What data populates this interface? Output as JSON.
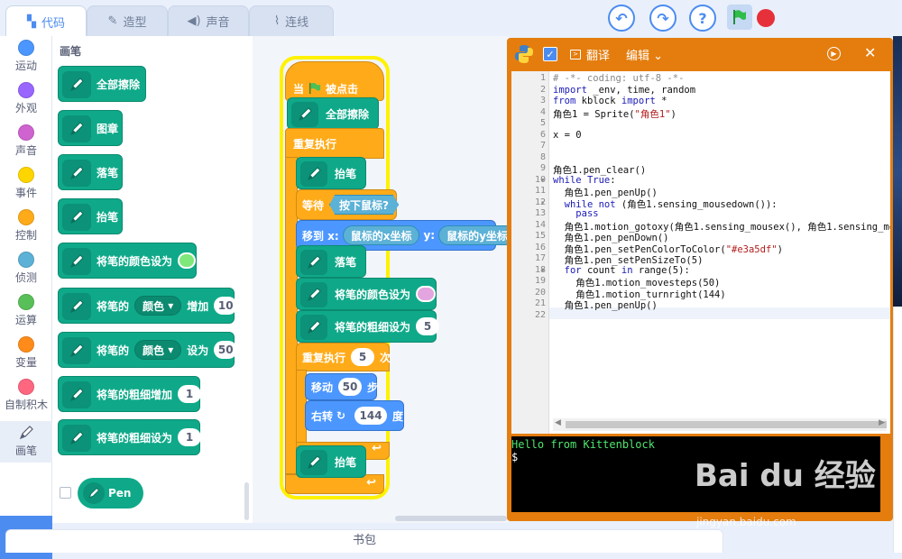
{
  "tabs": [
    {
      "label": "代码",
      "icon": "code-icon"
    },
    {
      "label": "造型",
      "icon": "brush-icon"
    },
    {
      "label": "声音",
      "icon": "speaker-icon"
    },
    {
      "label": "连线",
      "icon": "wire-icon"
    }
  ],
  "controls": {
    "undo": "↶",
    "redo": "↷",
    "help": "?"
  },
  "categories": [
    {
      "label": "运动",
      "color": "#4c97ff"
    },
    {
      "label": "外观",
      "color": "#9966ff"
    },
    {
      "label": "声音",
      "color": "#cf63cf"
    },
    {
      "label": "事件",
      "color": "#ffd500"
    },
    {
      "label": "控制",
      "color": "#ffab19"
    },
    {
      "label": "侦测",
      "color": "#5cb1d6"
    },
    {
      "label": "运算",
      "color": "#59c059"
    },
    {
      "label": "变量",
      "color": "#ff8c1a"
    },
    {
      "label": "自制积木",
      "color": "#ff6680"
    },
    {
      "label": "画笔",
      "color": "#0fa989"
    }
  ],
  "palette": {
    "title": "画笔",
    "blocks": {
      "clear": "全部擦除",
      "stamp": "图章",
      "pen_down": "落笔",
      "pen_up": "抬笔",
      "set_color": "将笔的颜色设为",
      "change_param_prefix": "将笔的",
      "param_option": "颜色",
      "change_word": "增加",
      "change_value": "10",
      "set_word": "设为",
      "set_value": "50",
      "change_size": "将笔的粗细增加",
      "change_size_value": "1",
      "set_size": "将笔的粗细设为",
      "set_size_value": "1"
    },
    "swatch_color": "#7ee87a",
    "extension_label": "Pen"
  },
  "script": {
    "when_flag": "当",
    "clicked": "被点击",
    "clear": "全部擦除",
    "forever": "重复执行",
    "pen_up_1": "抬笔",
    "wait": "等待",
    "mouse_down": "按下鼠标?",
    "goto": "移到 x:",
    "mouse_x": "鼠标的x坐标",
    "y_label": "y:",
    "mouse_y": "鼠标的y坐标",
    "pen_down": "落笔",
    "set_color": "将笔的颜色设为",
    "set_size": "将笔的粗细设为",
    "size_value": "5",
    "repeat": "重复执行",
    "repeat_count": "5",
    "times": "次",
    "move": "移动",
    "move_value": "50",
    "steps": "步",
    "turn": "右转",
    "turn_value": "144",
    "degrees": "度",
    "pen_up_2": "抬笔",
    "swatch_color": "#e3a5df"
  },
  "python": {
    "translate_label": "翻译",
    "edit_label": "编辑",
    "lines": [
      {
        "n": "1",
        "text": "# -*- coding: utf-8 -*-"
      },
      {
        "n": "2",
        "text": "import _env, time, random"
      },
      {
        "n": "3",
        "text": "from kblock import *"
      },
      {
        "n": "4",
        "text": "角色1 = Sprite(\"角色1\")"
      },
      {
        "n": "5",
        "text": ""
      },
      {
        "n": "6",
        "text": "x = 0"
      },
      {
        "n": "7",
        "text": ""
      },
      {
        "n": "8",
        "text": ""
      },
      {
        "n": "9",
        "text": "角色1.pen_clear()"
      },
      {
        "n": "10",
        "text": "while True:"
      },
      {
        "n": "11",
        "text": "  角色1.pen_penUp()"
      },
      {
        "n": "12",
        "text": "  while not (角色1.sensing_mousedown()):"
      },
      {
        "n": "13",
        "text": "    pass"
      },
      {
        "n": "14",
        "text": "  角色1.motion_gotoxy(角色1.sensing_mousex(), 角色1.sensing_mous"
      },
      {
        "n": "15",
        "text": "  角色1.pen_penDown()"
      },
      {
        "n": "16",
        "text": "  角色1.pen_setPenColorToColor(\"#e3a5df\")"
      },
      {
        "n": "17",
        "text": "  角色1.pen_setPenSizeTo(5)"
      },
      {
        "n": "18",
        "text": "  for count in range(5):"
      },
      {
        "n": "19",
        "text": "    角色1.motion_movesteps(50)"
      },
      {
        "n": "20",
        "text": "    角色1.motion_turnright(144)"
      },
      {
        "n": "21",
        "text": "  角色1.pen_penUp()"
      },
      {
        "n": "22",
        "text": ""
      }
    ],
    "terminal_output": "Hello from Kittenblock",
    "terminal_prompt": "$"
  },
  "backpack": "书包",
  "watermark": {
    "logo": "Bai du 经验",
    "url": "jingyan.baidu.com"
  }
}
